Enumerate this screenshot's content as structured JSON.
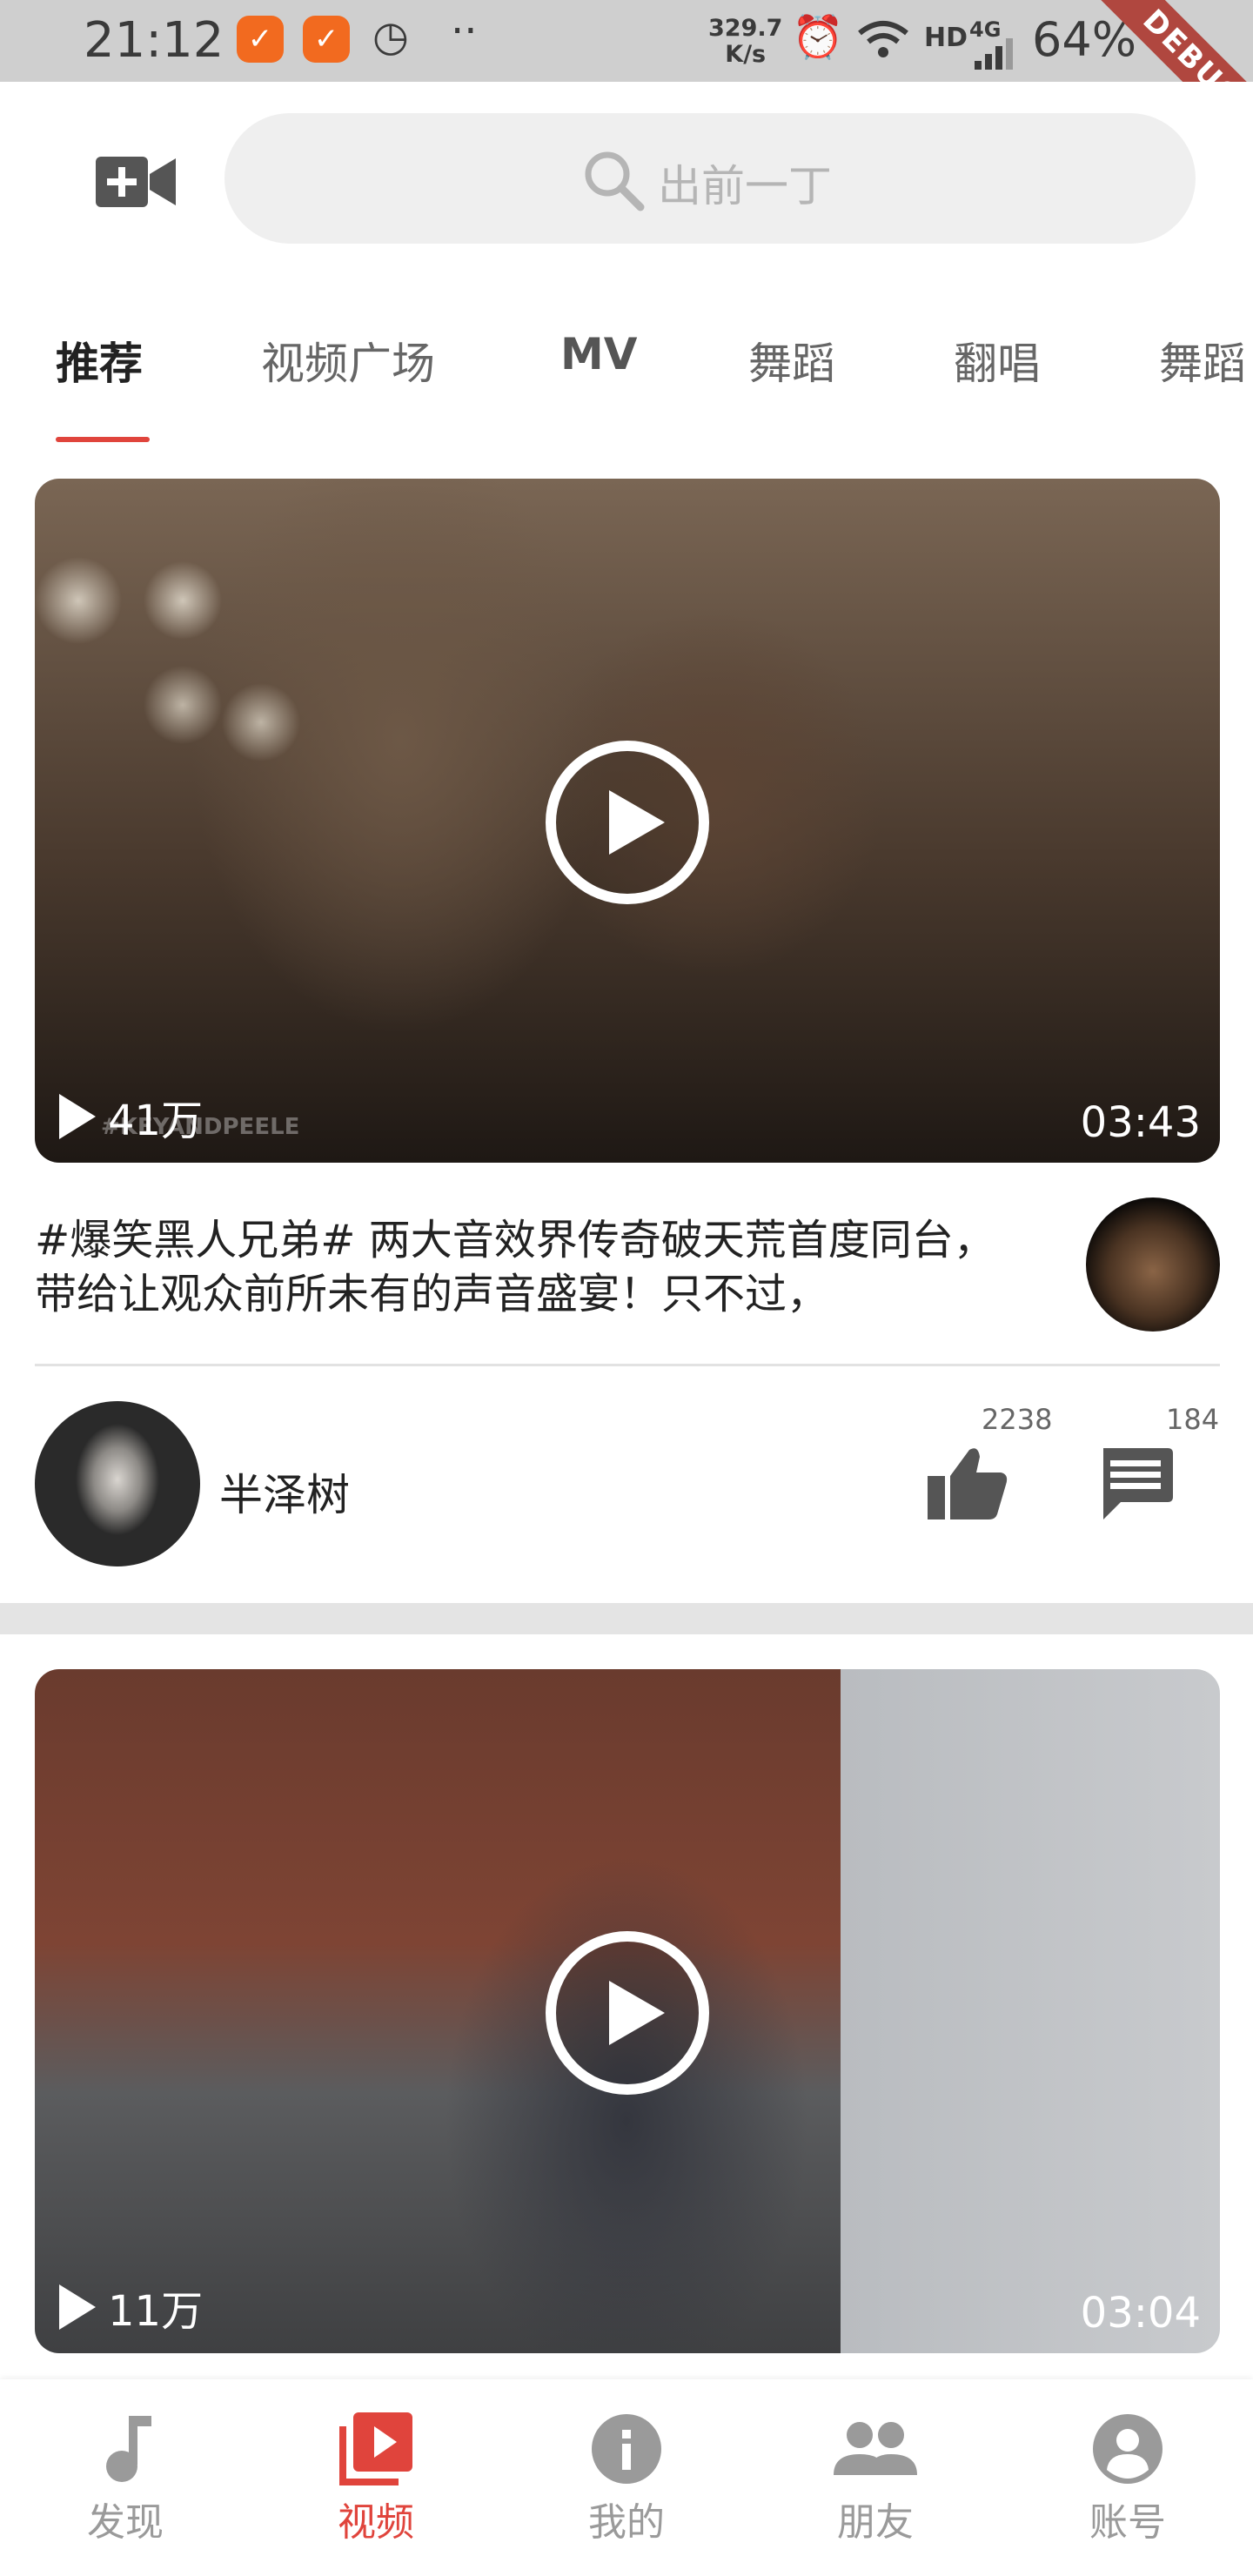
{
  "status_bar": {
    "time": "21:12",
    "net_speed_value": "329.7",
    "net_speed_unit": "K/s",
    "network_hd": "HD",
    "network_4g": "4G",
    "battery": "64%",
    "debug_banner": "DEBUG"
  },
  "header": {
    "camera_icon": "video-add-icon",
    "search_placeholder": "出前一丁"
  },
  "tabs": [
    {
      "label": "推荐",
      "active": true
    },
    {
      "label": "视频广场",
      "active": false
    },
    {
      "label": "MV",
      "active": false
    },
    {
      "label": "舞蹈",
      "active": false
    },
    {
      "label": "翻唱",
      "active": false
    },
    {
      "label": "舞蹈",
      "active": false
    }
  ],
  "videos": [
    {
      "views": "41万",
      "duration": "03:43",
      "watermark": "#KEYANDPEELE",
      "description": "#爆笑黑人兄弟# 两大音效界传奇破天荒首度同台，带给让观众前所未有的声音盛宴！只不过，",
      "author": "半泽树",
      "likes": "2238",
      "comments": "184"
    },
    {
      "views": "11万",
      "duration": "03:04"
    }
  ],
  "bottom_nav": [
    {
      "label": "发现",
      "icon": "music-note-icon",
      "active": false
    },
    {
      "label": "视频",
      "icon": "video-library-icon",
      "active": true
    },
    {
      "label": "我的",
      "icon": "info-icon",
      "active": false
    },
    {
      "label": "朋友",
      "icon": "people-icon",
      "active": false
    },
    {
      "label": "账号",
      "icon": "account-icon",
      "active": false
    }
  ],
  "colors": {
    "accent": "#e0443c",
    "status_bar": "#cfcfcf",
    "search_bg": "#efefef",
    "notification_badge": "#f26a1f"
  }
}
